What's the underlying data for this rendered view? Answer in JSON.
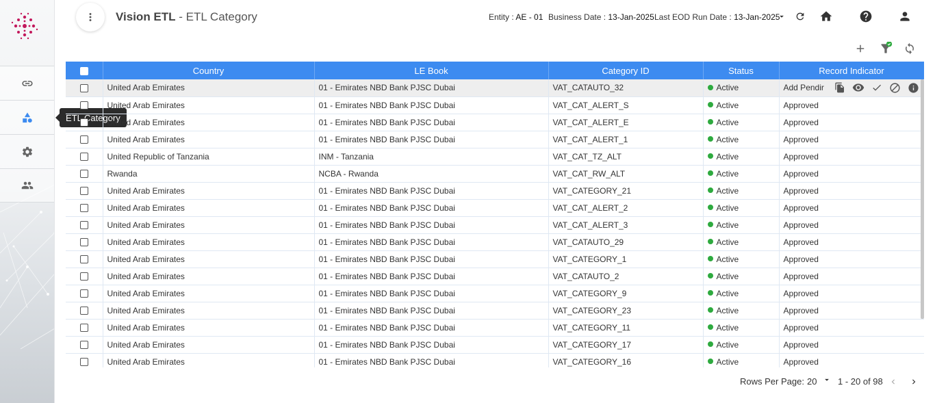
{
  "header": {
    "app_name": "Vision ETL",
    "page_title": " - ETL Category",
    "entity_label": "Entity : ",
    "entity_value": "AE - 01",
    "business_date_label": "Business Date : ",
    "business_date_value": "13-Jan-2025",
    "eod_label": "Last EOD Run Date : ",
    "eod_value": "13-Jan-2025"
  },
  "sidebar": {
    "items": [
      {
        "name": "link-icon"
      },
      {
        "name": "category-icon"
      },
      {
        "name": "gear-icon"
      },
      {
        "name": "users-icon"
      }
    ],
    "tooltip": "ETL Category"
  },
  "table": {
    "columns": [
      "Country",
      "LE Book",
      "Category ID",
      "Status",
      "Record Indicator"
    ],
    "rows": [
      {
        "country": "United Arab Emirates",
        "le_book": "01 - Emirates NBD Bank PJSC Dubai",
        "category_id": "VAT_CATAUTO_32",
        "status": "Active",
        "indicator": "Add Pendir"
      },
      {
        "country": "United Arab Emirates",
        "le_book": "01 - Emirates NBD Bank PJSC Dubai",
        "category_id": "VAT_CAT_ALERT_S",
        "status": "Active",
        "indicator": "Approved"
      },
      {
        "country": "United Arab Emirates",
        "le_book": "01 - Emirates NBD Bank PJSC Dubai",
        "category_id": "VAT_CAT_ALERT_E",
        "status": "Active",
        "indicator": "Approved"
      },
      {
        "country": "United Arab Emirates",
        "le_book": "01 - Emirates NBD Bank PJSC Dubai",
        "category_id": "VAT_CAT_ALERT_1",
        "status": "Active",
        "indicator": "Approved"
      },
      {
        "country": "United Republic of Tanzania",
        "le_book": "INM - Tanzania",
        "category_id": "VAT_CAT_TZ_ALT",
        "status": "Active",
        "indicator": "Approved"
      },
      {
        "country": "Rwanda",
        "le_book": "NCBA - Rwanda",
        "category_id": "VAT_CAT_RW_ALT",
        "status": "Active",
        "indicator": "Approved"
      },
      {
        "country": "United Arab Emirates",
        "le_book": "01 - Emirates NBD Bank PJSC Dubai",
        "category_id": "VAT_CATEGORY_21",
        "status": "Active",
        "indicator": "Approved"
      },
      {
        "country": "United Arab Emirates",
        "le_book": "01 - Emirates NBD Bank PJSC Dubai",
        "category_id": "VAT_CAT_ALERT_2",
        "status": "Active",
        "indicator": "Approved"
      },
      {
        "country": "United Arab Emirates",
        "le_book": "01 - Emirates NBD Bank PJSC Dubai",
        "category_id": "VAT_CAT_ALERT_3",
        "status": "Active",
        "indicator": "Approved"
      },
      {
        "country": "United Arab Emirates",
        "le_book": "01 - Emirates NBD Bank PJSC Dubai",
        "category_id": "VAT_CATAUTO_29",
        "status": "Active",
        "indicator": "Approved"
      },
      {
        "country": "United Arab Emirates",
        "le_book": "01 - Emirates NBD Bank PJSC Dubai",
        "category_id": "VAT_CATEGORY_1",
        "status": "Active",
        "indicator": "Approved"
      },
      {
        "country": "United Arab Emirates",
        "le_book": "01 - Emirates NBD Bank PJSC Dubai",
        "category_id": "VAT_CATAUTO_2",
        "status": "Active",
        "indicator": "Approved"
      },
      {
        "country": "United Arab Emirates",
        "le_book": "01 - Emirates NBD Bank PJSC Dubai",
        "category_id": "VAT_CATEGORY_9",
        "status": "Active",
        "indicator": "Approved"
      },
      {
        "country": "United Arab Emirates",
        "le_book": "01 - Emirates NBD Bank PJSC Dubai",
        "category_id": "VAT_CATEGORY_23",
        "status": "Active",
        "indicator": "Approved"
      },
      {
        "country": "United Arab Emirates",
        "le_book": "01 - Emirates NBD Bank PJSC Dubai",
        "category_id": "VAT_CATEGORY_11",
        "status": "Active",
        "indicator": "Approved"
      },
      {
        "country": "United Arab Emirates",
        "le_book": "01 - Emirates NBD Bank PJSC Dubai",
        "category_id": "VAT_CATEGORY_17",
        "status": "Active",
        "indicator": "Approved"
      },
      {
        "country": "United Arab Emirates",
        "le_book": "01 - Emirates NBD Bank PJSC Dubai",
        "category_id": "VAT_CATEGORY_16",
        "status": "Active",
        "indicator": "Approved"
      }
    ],
    "row_actions": [
      "copy-icon",
      "eye-icon",
      "check-icon",
      "block-icon",
      "info-icon"
    ]
  },
  "footer": {
    "rows_per_page_label": "Rows Per Page:",
    "rows_per_page_value": "20",
    "range": "1 - 20 of 98"
  },
  "colors": {
    "header_blue": "#3d8bf0",
    "active_green": "#2eaa3f",
    "logo_magenta": "#c2185b"
  }
}
